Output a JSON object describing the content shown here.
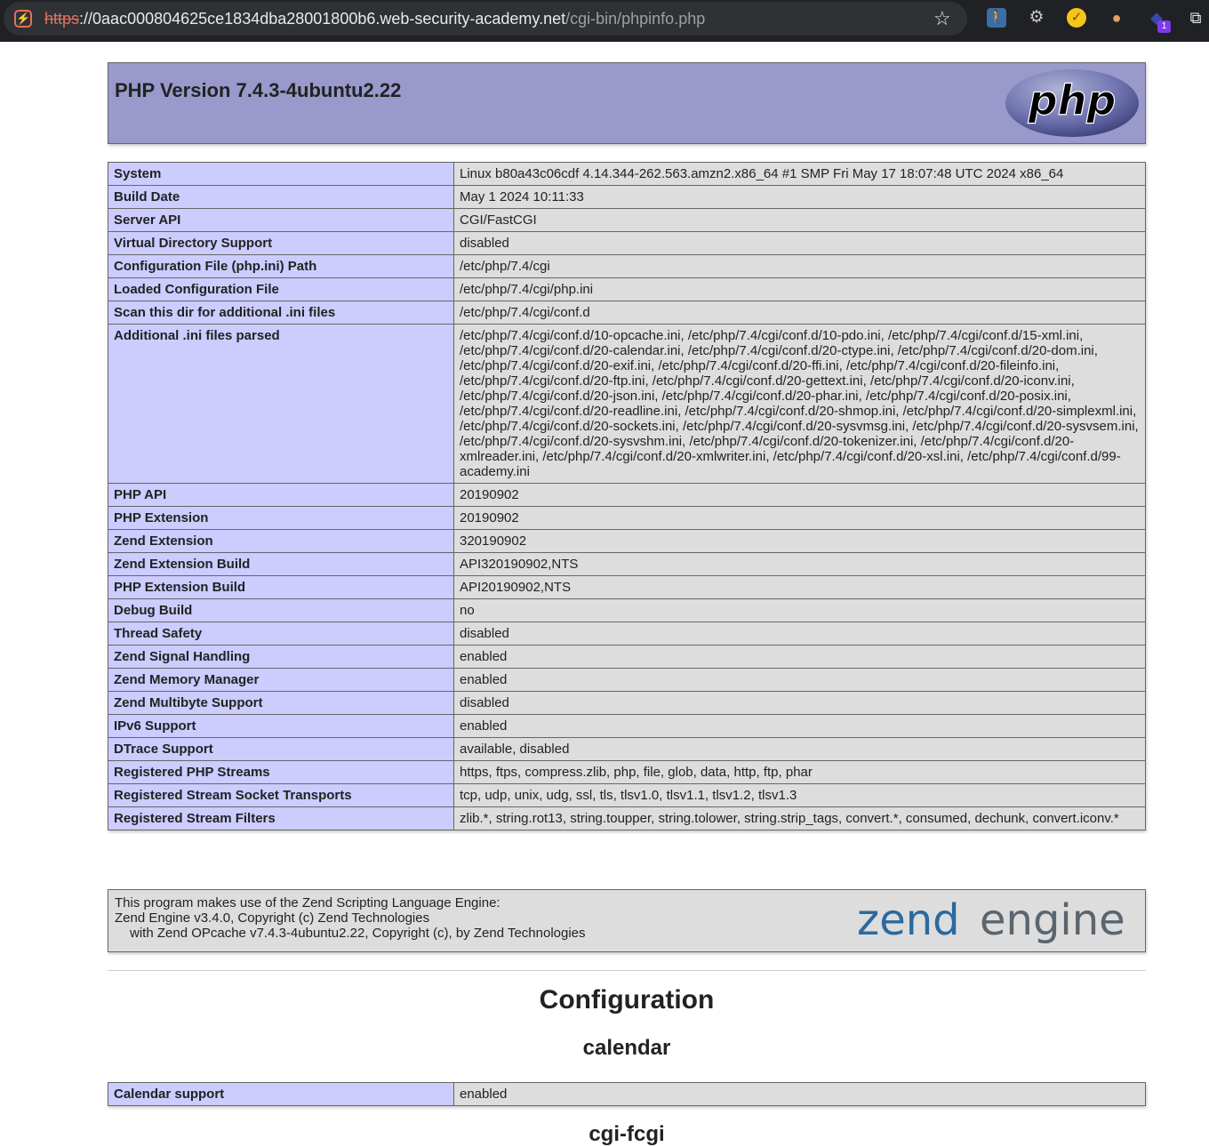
{
  "browser": {
    "url_scheme": "https",
    "url_host": "://0aac000804625ce1834dba28001800b6.web-security-academy.net",
    "url_path": "/cgi-bin/phpinfo.php",
    "extension_badge": "1"
  },
  "header": {
    "title": "PHP Version 7.4.3-4ubuntu2.22",
    "logo_text": "php"
  },
  "info_rows": [
    {
      "label": "System",
      "value": "Linux b80a43c06cdf 4.14.344-262.563.amzn2.x86_64 #1 SMP Fri May 17 18:07:48 UTC 2024 x86_64"
    },
    {
      "label": "Build Date",
      "value": "May 1 2024 10:11:33"
    },
    {
      "label": "Server API",
      "value": "CGI/FastCGI"
    },
    {
      "label": "Virtual Directory Support",
      "value": "disabled"
    },
    {
      "label": "Configuration File (php.ini) Path",
      "value": "/etc/php/7.4/cgi"
    },
    {
      "label": "Loaded Configuration File",
      "value": "/etc/php/7.4/cgi/php.ini"
    },
    {
      "label": "Scan this dir for additional .ini files",
      "value": "/etc/php/7.4/cgi/conf.d"
    },
    {
      "label": "Additional .ini files parsed",
      "value": "/etc/php/7.4/cgi/conf.d/10-opcache.ini, /etc/php/7.4/cgi/conf.d/10-pdo.ini, /etc/php/7.4/cgi/conf.d/15-xml.ini, /etc/php/7.4/cgi/conf.d/20-calendar.ini, /etc/php/7.4/cgi/conf.d/20-ctype.ini, /etc/php/7.4/cgi/conf.d/20-dom.ini, /etc/php/7.4/cgi/conf.d/20-exif.ini, /etc/php/7.4/cgi/conf.d/20-ffi.ini, /etc/php/7.4/cgi/conf.d/20-fileinfo.ini, /etc/php/7.4/cgi/conf.d/20-ftp.ini, /etc/php/7.4/cgi/conf.d/20-gettext.ini, /etc/php/7.4/cgi/conf.d/20-iconv.ini, /etc/php/7.4/cgi/conf.d/20-json.ini, /etc/php/7.4/cgi/conf.d/20-phar.ini, /etc/php/7.4/cgi/conf.d/20-posix.ini, /etc/php/7.4/cgi/conf.d/20-readline.ini, /etc/php/7.4/cgi/conf.d/20-shmop.ini, /etc/php/7.4/cgi/conf.d/20-simplexml.ini, /etc/php/7.4/cgi/conf.d/20-sockets.ini, /etc/php/7.4/cgi/conf.d/20-sysvmsg.ini, /etc/php/7.4/cgi/conf.d/20-sysvsem.ini, /etc/php/7.4/cgi/conf.d/20-sysvshm.ini, /etc/php/7.4/cgi/conf.d/20-tokenizer.ini, /etc/php/7.4/cgi/conf.d/20-xmlreader.ini, /etc/php/7.4/cgi/conf.d/20-xmlwriter.ini, /etc/php/7.4/cgi/conf.d/20-xsl.ini, /etc/php/7.4/cgi/conf.d/99-academy.ini"
    },
    {
      "label": "PHP API",
      "value": "20190902"
    },
    {
      "label": "PHP Extension",
      "value": "20190902"
    },
    {
      "label": "Zend Extension",
      "value": "320190902"
    },
    {
      "label": "Zend Extension Build",
      "value": "API320190902,NTS"
    },
    {
      "label": "PHP Extension Build",
      "value": "API20190902,NTS"
    },
    {
      "label": "Debug Build",
      "value": "no"
    },
    {
      "label": "Thread Safety",
      "value": "disabled"
    },
    {
      "label": "Zend Signal Handling",
      "value": "enabled"
    },
    {
      "label": "Zend Memory Manager",
      "value": "enabled"
    },
    {
      "label": "Zend Multibyte Support",
      "value": "disabled"
    },
    {
      "label": "IPv6 Support",
      "value": "enabled"
    },
    {
      "label": "DTrace Support",
      "value": "available, disabled"
    },
    {
      "label": "Registered PHP Streams",
      "value": "https, ftps, compress.zlib, php, file, glob, data, http, ftp, phar"
    },
    {
      "label": "Registered Stream Socket Transports",
      "value": "tcp, udp, unix, udg, ssl, tls, tlsv1.0, tlsv1.1, tlsv1.2, tlsv1.3"
    },
    {
      "label": "Registered Stream Filters",
      "value": "zlib.*, string.rot13, string.toupper, string.tolower, string.strip_tags, convert.*, consumed, dechunk, convert.iconv.*"
    }
  ],
  "zend": {
    "line1": "This program makes use of the Zend Scripting Language Engine:",
    "line2": "Zend Engine v3.4.0, Copyright (c) Zend Technologies",
    "line3": "with Zend OPcache v7.4.3-4ubuntu2.22, Copyright (c), by Zend Technologies",
    "logo_word1": "zend",
    "logo_word2": "engine"
  },
  "configuration": {
    "heading": "Configuration",
    "section1": "calendar",
    "section1_rows": [
      {
        "label": "Calendar support",
        "value": "enabled"
      }
    ],
    "section2": "cgi-fcgi"
  }
}
